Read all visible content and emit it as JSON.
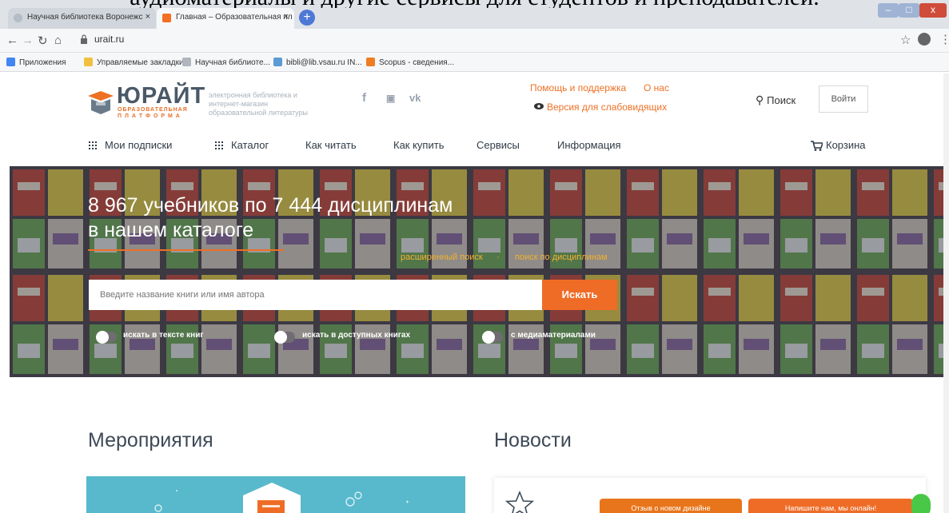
{
  "overlay_caption": "аудиоматериалы и другие сервисы для студентов и преподавателей.",
  "browser": {
    "tabs": [
      {
        "label": "Научная библиотека Воронежс"
      },
      {
        "label": "Главная – Образовательная пл"
      }
    ],
    "new_tab": "+",
    "close_glyph": "×",
    "url": "urait.ru",
    "window_controls": {
      "min": "–",
      "max": "□",
      "close": "x"
    }
  },
  "bookmarks": [
    {
      "label": "Приложения",
      "icon": "apps-grid-icon",
      "color": "#4285f4"
    },
    {
      "label": "Управляемые закладки",
      "icon": "folder-icon",
      "color": "#f2c040"
    },
    {
      "label": "Научная библиоте...",
      "icon": "library-icon",
      "color": "#b0b6bd"
    },
    {
      "label": "bibli@lib.vsau.ru IN...",
      "icon": "mail-icon",
      "color": "#5a9bd5"
    },
    {
      "label": "Scopus - сведения...",
      "icon": "scopus-icon",
      "color": "#ef7d22"
    }
  ],
  "header": {
    "logo_name": "ЮРАЙТ",
    "logo_sub_1": "ОБРАЗОВАТЕЛЬНАЯ",
    "logo_sub_2": "П Л А Т Ф О Р М А",
    "tagline": "электронная библиотека и интернет-магазин образовательной литературы",
    "social": [
      "f",
      "▣",
      "vk"
    ],
    "help": "Помощь и поддержка",
    "about": "О нас",
    "low_vision": "Версия для слабовидящих",
    "search": "Поиск",
    "login": "Войти"
  },
  "nav": {
    "subscriptions": "Мои подписки",
    "catalog": "Каталог",
    "how_read": "Как читать",
    "how_buy": "Как купить",
    "services": "Сервисы",
    "info": "Информация",
    "cart": "Корзина"
  },
  "hero": {
    "title_line1": "8 967 учебников по 7 444 дисциплинам",
    "title_line2": "в нашем каталоге",
    "advanced_search": "расширенный поиск",
    "separator": "·",
    "discipline_search": "поиск по дисциплинам",
    "search_placeholder": "Введите название книги или имя автора",
    "search_button": "Искать",
    "toggles": [
      {
        "label": "искать в тексте книг"
      },
      {
        "label": "искать в доступных книгах"
      },
      {
        "label": "с медиаматериалами"
      }
    ]
  },
  "sections": {
    "events_title": "Мероприятия",
    "news_title": "Новости",
    "feedback_button": "Отзыв о новом дизайне",
    "contact_button": "Напишите нам, мы онлайн!"
  },
  "colors": {
    "accent": "#ef6c26",
    "link": "#ee7025",
    "hero_link": "#f3b12e",
    "events_card": "#58b9cc",
    "online_indicator": "#49c847"
  }
}
